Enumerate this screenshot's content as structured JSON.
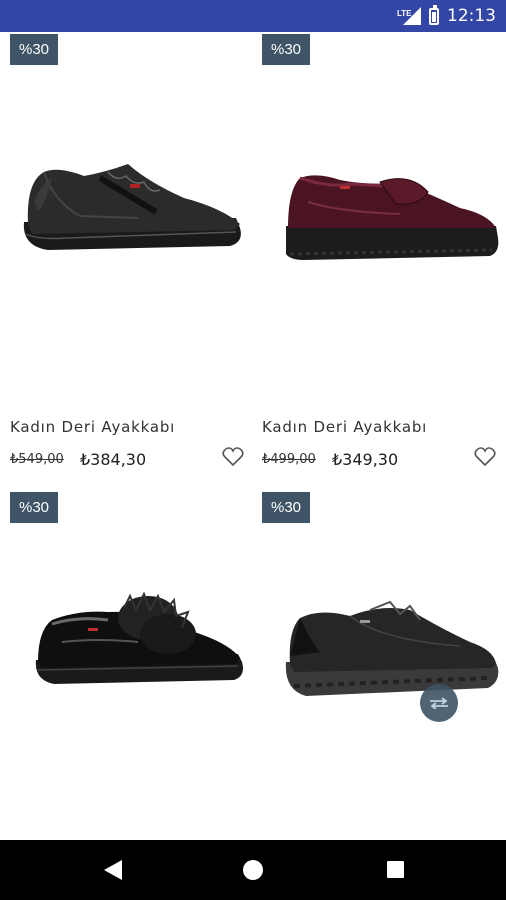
{
  "status_bar": {
    "network": "LTE",
    "time": "12:13"
  },
  "products": [
    {
      "badge": "%30",
      "name": "Kadın Deri Ayakkabı",
      "old_price": "₺549,00",
      "new_price": "₺384,30",
      "image": "black-leather-sneaker"
    },
    {
      "badge": "%30",
      "name": "Kadın Deri Ayakkabı",
      "old_price": "₺499,00",
      "new_price": "₺349,30",
      "image": "burgundy-patent-loafer"
    },
    {
      "badge": "%30",
      "image": "black-patent-fur-sneaker"
    },
    {
      "badge": "%30",
      "image": "black-leather-laceup-sneaker"
    }
  ],
  "colors": {
    "status_bar": "#3346a6",
    "badge": "#3f5466",
    "navbar": "#000000"
  }
}
